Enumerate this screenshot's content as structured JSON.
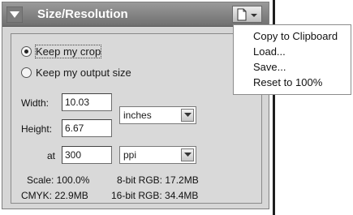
{
  "panel": {
    "title": "Size/Resolution",
    "collapse_icon": "triangle-down-icon",
    "menu_icon": "page-menu-icon"
  },
  "options": {
    "keep_crop_label": "Keep my crop",
    "keep_output_label": "Keep my output size",
    "selected": "Keep my crop"
  },
  "fields": {
    "width_label": "Width:",
    "width_value": "10.03",
    "height_label": "Height:",
    "height_value": "6.67",
    "units": "inches",
    "at_label": "at",
    "resolution_value": "300",
    "resolution_units": "ppi"
  },
  "info": {
    "scale": "Scale: 100.0%",
    "cmyk": "CMYK: 22.9MB",
    "rgb8": "8-bit RGB: 17.2MB",
    "rgb16": "16-bit RGB: 34.4MB"
  },
  "menu": {
    "items": [
      "Copy to Clipboard",
      "Load...",
      "Save...",
      "Reset to 100%"
    ]
  },
  "colors": {
    "titlebar": "#7f7f7f",
    "panel_bg": "#d6d6d6"
  }
}
